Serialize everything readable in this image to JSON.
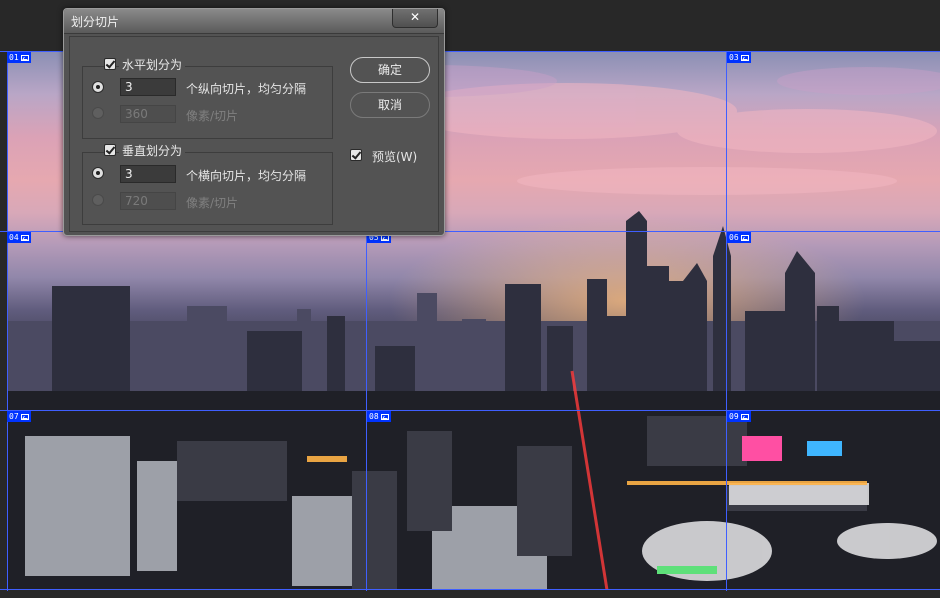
{
  "dialog": {
    "title": "划分切片",
    "close_label": "✕"
  },
  "horizontal": {
    "checkbox_label": "水平划分为",
    "checked": true,
    "count_value": "3",
    "count_label": "个纵向切片，均匀分隔",
    "pixels_value": "360",
    "pixels_label": "像素/切片"
  },
  "vertical": {
    "checkbox_label": "垂直划分为",
    "checked": true,
    "count_value": "3",
    "count_label": "个横向切片，均匀分隔",
    "pixels_value": "720",
    "pixels_label": "像素/切片"
  },
  "buttons": {
    "ok_label": "确定",
    "cancel_label": "取消"
  },
  "preview": {
    "label": "预览(W)",
    "checked": true
  },
  "slices": [
    "01",
    "03",
    "04",
    "05",
    "06",
    "07",
    "08",
    "09"
  ],
  "colors": {
    "guide": "#3f5fff",
    "slice_badge": "#0033ff",
    "dialog_bg": "#535353"
  }
}
